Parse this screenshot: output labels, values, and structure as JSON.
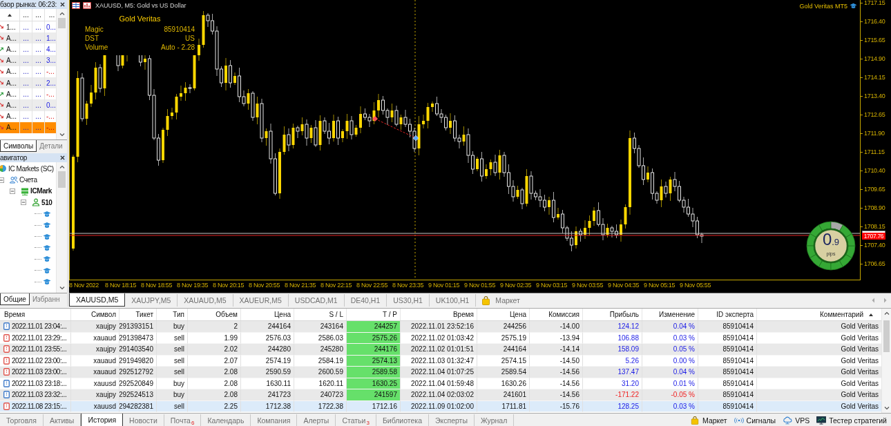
{
  "market_watch": {
    "title": "бзор рынка: 06:23:",
    "columns": [
      {
        "sorted": true
      },
      {
        "label": "...",
        "sorted": false
      },
      {
        "label": "...",
        "sorted": false
      },
      {
        "label": "...",
        "sorted": false
      }
    ],
    "rows": [
      {
        "rising": false,
        "cells": [
          "1...",
          "...",
          "...",
          "0..."
        ],
        "negative": false,
        "selected": false
      },
      {
        "rising": false,
        "cells": [
          "A...",
          "...",
          "...",
          "1..."
        ],
        "negative": false,
        "selected": false
      },
      {
        "rising": true,
        "cells": [
          "A...",
          "...",
          "...",
          "4..."
        ],
        "negative": false,
        "selected": false
      },
      {
        "rising": false,
        "cells": [
          "A...",
          "...",
          "...",
          "3..."
        ],
        "negative": false,
        "selected": false
      },
      {
        "rising": false,
        "cells": [
          "A...",
          "...",
          "...",
          "-..."
        ],
        "negative": true,
        "selected": false
      },
      {
        "rising": false,
        "cells": [
          "A...",
          "...",
          "...",
          "2..."
        ],
        "negative": false,
        "selected": false
      },
      {
        "rising": true,
        "cells": [
          "A...",
          "...",
          "...",
          "-..."
        ],
        "negative": true,
        "selected": false
      },
      {
        "rising": false,
        "cells": [
          "A...",
          "...",
          "...",
          "0..."
        ],
        "negative": false,
        "selected": false
      },
      {
        "rising": false,
        "cells": [
          "A...",
          "...",
          "...",
          "-..."
        ],
        "negative": true,
        "selected": false
      },
      {
        "rising": false,
        "cells": [
          "A...",
          "...",
          "...",
          "-..."
        ],
        "negative": true,
        "selected": true
      }
    ]
  },
  "market_watch_tabs": [
    {
      "label": "Символы",
      "selected": true
    },
    {
      "label": "Детали",
      "selected": false
    }
  ],
  "navigator": {
    "title": "авигатор",
    "tree": [
      {
        "kind": "broker",
        "label": "IC Markets (SC)",
        "children": [
          {
            "kind": "accounts",
            "label": "Счета",
            "expanded": true,
            "children": [
              {
                "kind": "server",
                "label": "ICMark",
                "expanded": true,
                "children": [
                  {
                    "kind": "account",
                    "label": "510",
                    "expanded": true,
                    "children": [
                      {
                        "kind": "expert"
                      },
                      {
                        "kind": "expert"
                      },
                      {
                        "kind": "expert"
                      },
                      {
                        "kind": "expert"
                      },
                      {
                        "kind": "expert"
                      },
                      {
                        "kind": "expert"
                      },
                      {
                        "kind": "expert"
                      }
                    ]
                  }
                ]
              }
            ]
          }
        ]
      }
    ]
  },
  "navigator_tabs": [
    {
      "label": "Общие",
      "selected": true
    },
    {
      "label": "Избранн",
      "selected": false
    }
  ],
  "chart": {
    "title": "XAUUSD, M5: Gold vs US Dollar",
    "expert_label": "Gold Veritas MT5",
    "info_panel": {
      "title": "Gold Veritas",
      "rows": [
        {
          "label": "Magic",
          "value": "85910414"
        },
        {
          "label": "DST",
          "value": "US"
        },
        {
          "label": "Volume",
          "value": "Auto - 2.28"
        }
      ]
    },
    "price_axis": [
      "1717.15",
      "1716.40",
      "1715.65",
      "1714.90",
      "1714.15",
      "1713.40",
      "1712.65",
      "1711.90",
      "1711.15",
      "1710.40",
      "1709.65",
      "1708.90",
      "1708.15",
      "1707.40",
      "1706.65"
    ],
    "time_axis": [
      "8 Nov 2022",
      "8 Nov 18:15",
      "8 Nov 18:55",
      "8 Nov 19:35",
      "8 Nov 20:15",
      "8 Nov 20:55",
      "8 Nov 21:35",
      "8 Nov 22:15",
      "8 Nov 22:55",
      "8 Nov 23:35",
      "9 Nov 01:15",
      "9 Nov 01:55",
      "9 Nov 02:35",
      "9 Nov 03:15",
      "9 Nov 03:55",
      "9 Nov 04:35",
      "9 Nov 05:15",
      "9 Nov 05:55"
    ],
    "ask_price": "1707.76",
    "spread_gauge": {
      "whole": "0",
      "fraction": ".9",
      "unit": "pips",
      "level": 0.92
    }
  },
  "chart_tabs": [
    {
      "kind": "chart",
      "label": "XAUUSD,M5",
      "selected": true
    },
    {
      "kind": "chart",
      "label": "XAUJPY,M5",
      "selected": false
    },
    {
      "kind": "chart",
      "label": "XAUAUD,M5",
      "selected": false
    },
    {
      "kind": "chart",
      "label": "XAUEUR,M5",
      "selected": false
    },
    {
      "kind": "chart",
      "label": "USDCAD,M1",
      "selected": false
    },
    {
      "kind": "chart",
      "label": "DE40,H1",
      "selected": false
    },
    {
      "kind": "chart",
      "label": "US30,H1",
      "selected": false
    },
    {
      "kind": "chart",
      "label": "UK100,H1",
      "selected": false
    },
    {
      "kind": "market",
      "label": "Маркет",
      "selected": false
    }
  ],
  "history": {
    "columns": [
      {
        "label": "Время",
        "sorted": false
      },
      {
        "label": "Символ",
        "sorted": false
      },
      {
        "label": "Тикет",
        "sorted": false
      },
      {
        "label": "Тип",
        "sorted": false
      },
      {
        "label": "Объем",
        "sorted": false
      },
      {
        "label": "Цена",
        "sorted": false
      },
      {
        "label": "S / L",
        "sorted": false
      },
      {
        "label": "T / P",
        "sorted": false
      },
      {
        "label": "Время",
        "sorted": false
      },
      {
        "label": "Цена",
        "sorted": false
      },
      {
        "label": "Комиссия",
        "sorted": false
      },
      {
        "label": "Прибыль",
        "sorted": false
      },
      {
        "label": "Изменение",
        "sorted": false
      },
      {
        "label": "ID эксперта",
        "sorted": false
      },
      {
        "label": "Комментарий",
        "sorted": true
      }
    ],
    "rows": [
      {
        "color": "#3c78c8",
        "cells": [
          "2022.11.01 23:04:...",
          "xaujpy",
          "291393151",
          "buy",
          "2",
          "244164",
          "243164",
          "244257",
          "2022.11.01 23:52:16",
          "244256",
          "-14.00",
          "124.12",
          "0.04 %",
          "85910414",
          "Gold Veritas"
        ],
        "tp_hit": true,
        "loss": false,
        "selected": false
      },
      {
        "color": "#e0524a",
        "cells": [
          "2022.11.01 23:29:...",
          "xauaud",
          "291398473",
          "sell",
          "1.99",
          "2576.03",
          "2586.03",
          "2575.26",
          "2022.11.02 01:03:42",
          "2575.19",
          "-13.94",
          "106.88",
          "0.03 %",
          "85910414",
          "Gold Veritas"
        ],
        "tp_hit": true,
        "loss": false,
        "selected": false
      },
      {
        "color": "#e0524a",
        "cells": [
          "2022.11.01 23:55:...",
          "xaujpy",
          "291403540",
          "sell",
          "2.02",
          "244280",
          "245280",
          "244176",
          "2022.11.02 01:01:51",
          "244164",
          "-14.14",
          "158.09",
          "0.05 %",
          "85910414",
          "Gold Veritas"
        ],
        "tp_hit": true,
        "loss": false,
        "selected": false
      },
      {
        "color": "#e0524a",
        "cells": [
          "2022.11.02 23:00:...",
          "xauaud",
          "291949820",
          "sell",
          "2.07",
          "2574.19",
          "2584.19",
          "2574.13",
          "2022.11.03 01:32:47",
          "2574.15",
          "-14.50",
          "5.26",
          "0.00 %",
          "85910414",
          "Gold Veritas"
        ],
        "tp_hit": true,
        "loss": false,
        "selected": false
      },
      {
        "color": "#e0524a",
        "cells": [
          "2022.11.03 23:00:...",
          "xauaud",
          "292512792",
          "sell",
          "2.08",
          "2590.59",
          "2600.59",
          "2589.58",
          "2022.11.04 01:07:25",
          "2589.54",
          "-14.56",
          "137.47",
          "0.04 %",
          "85910414",
          "Gold Veritas"
        ],
        "tp_hit": true,
        "loss": false,
        "selected": false
      },
      {
        "color": "#3c78c8",
        "cells": [
          "2022.11.03 23:18:...",
          "xauusd",
          "292520849",
          "buy",
          "2.08",
          "1630.11",
          "1620.11",
          "1630.25",
          "2022.11.04 01:59:48",
          "1630.26",
          "-14.56",
          "31.20",
          "0.01 %",
          "85910414",
          "Gold Veritas"
        ],
        "tp_hit": true,
        "loss": false,
        "selected": false
      },
      {
        "color": "#3c78c8",
        "cells": [
          "2022.11.03 23:32:...",
          "xaujpy",
          "292524513",
          "buy",
          "2.08",
          "241723",
          "240723",
          "241597",
          "2022.11.04 02:03:02",
          "241601",
          "-14.56",
          "-171.22",
          "-0.05 %",
          "85910414",
          "Gold Veritas"
        ],
        "tp_hit": true,
        "loss": true,
        "selected": false
      },
      {
        "color": "#e0524a",
        "cells": [
          "2022.11.08 23:15:...",
          "xauusd",
          "294282381",
          "sell",
          "2.25",
          "1712.38",
          "1722.38",
          "1712.16",
          "2022.11.09 01:02:00",
          "1711.81",
          "-15.76",
          "128.25",
          "0.03 %",
          "85910414",
          "Gold Veritas"
        ],
        "tp_hit": false,
        "loss": false,
        "selected": true
      }
    ]
  },
  "bottom_tabs": [
    {
      "label": "Торговля",
      "selected": false
    },
    {
      "label": "Активы",
      "selected": false
    },
    {
      "label": "История",
      "selected": true
    },
    {
      "label": "Новости",
      "selected": false
    },
    {
      "label": "Почта",
      "badge": "6",
      "selected": false
    },
    {
      "label": "Календарь",
      "selected": false
    },
    {
      "label": "Компания",
      "selected": false
    },
    {
      "label": "Алерты",
      "selected": false
    },
    {
      "label": "Статьи",
      "badge": "3",
      "selected": false
    },
    {
      "label": "Библиотека",
      "selected": false
    },
    {
      "label": "Эксперты",
      "selected": false
    },
    {
      "label": "Журнал",
      "selected": false
    }
  ],
  "bottom_links": [
    {
      "kind": "market",
      "label": "Маркет"
    },
    {
      "kind": "signals",
      "label": "Сигналы"
    },
    {
      "kind": "vps",
      "label": "VPS"
    },
    {
      "kind": "tester",
      "label": "Тестер стратегий"
    }
  ]
}
